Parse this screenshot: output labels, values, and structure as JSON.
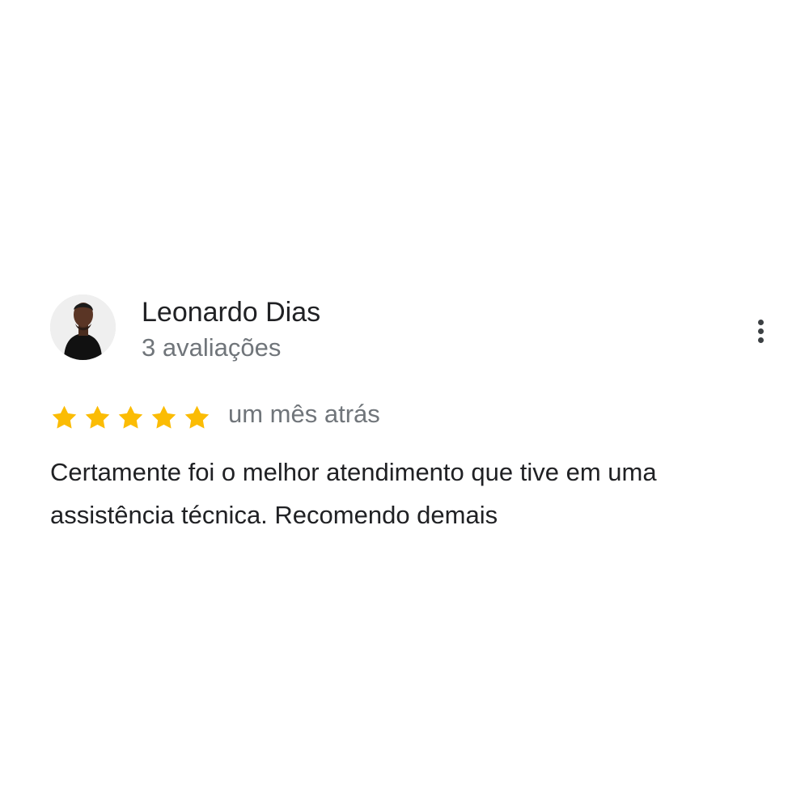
{
  "review": {
    "reviewer_name": "Leonardo Dias",
    "review_count": "3 avaliações",
    "rating": 5,
    "rating_max": 5,
    "date": "um mês atrás",
    "text": "Certamente foi o melhor atendimento que tive em uma assistência técnica. Recomendo demais",
    "avatar_icon": "reviewer-photo",
    "star_icon": "star-icon",
    "menu_icon": "more-vert-icon"
  },
  "colors": {
    "star": "#fbbc04",
    "name": "#202124",
    "secondary": "#70757a",
    "menu_dots": "#3c4043"
  }
}
